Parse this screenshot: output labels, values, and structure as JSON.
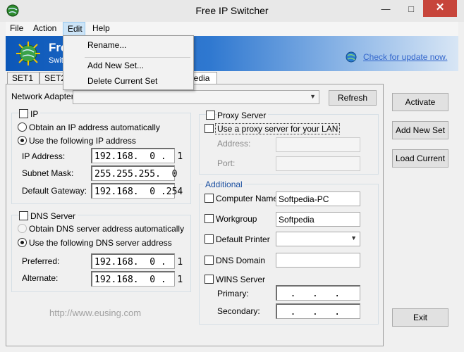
{
  "window": {
    "title": "Free IP Switcher"
  },
  "menu": {
    "file": "File",
    "action": "Action",
    "edit": "Edit",
    "help": "Help"
  },
  "edit_menu": {
    "rename": "Rename...",
    "add_new_set": "Add New Set...",
    "delete_current_set": "Delete Current Set"
  },
  "banner": {
    "title": "Fre",
    "subtitle": "Swit",
    "update_link": "Check for update now."
  },
  "tabs": {
    "set1": "SET1",
    "set2": "SET2",
    "partial_tab": "pedia"
  },
  "adapter": {
    "label": "Network Adapter:",
    "refresh": "Refresh"
  },
  "ip": {
    "label": "IP",
    "auto": "Obtain an IP address automatically",
    "manual": "Use the following IP address",
    "address_label": "IP Address:",
    "address": "192.168.  0 .  1",
    "mask_label": "Subnet Mask:",
    "mask": "255.255.255.  0",
    "gateway_label": "Default Gateway:",
    "gateway": "192.168.  0 .254"
  },
  "dns": {
    "label": "DNS Server",
    "auto": "Obtain DNS server address automatically",
    "manual": "Use the following DNS server address",
    "preferred_label": "Preferred:",
    "preferred": "192.168.  0 .  1",
    "alternate_label": "Alternate:",
    "alternate": "192.168.  0 .  1"
  },
  "proxy": {
    "label": "Proxy Server",
    "use_proxy": "Use a proxy server for your LAN",
    "address_label": "Address:",
    "port_label": "Port:"
  },
  "additional": {
    "label": "Additional",
    "computer_name_label": "Computer Name",
    "computer_name": "Softpedia-PC",
    "workgroup_label": "Workgroup",
    "workgroup": "Softpedia",
    "printer_label": "Default Printer",
    "dns_domain_label": "DNS Domain",
    "wins_label": "WINS Server",
    "primary_label": "Primary:",
    "primary": "  .   .   .",
    "secondary_label": "Secondary:",
    "secondary": "  .   .   ."
  },
  "side_buttons": {
    "activate": "Activate",
    "add_new_set": "Add New Set",
    "load_current": "Load Current",
    "exit": "Exit"
  },
  "watermark": "http://www.eusing.com"
}
